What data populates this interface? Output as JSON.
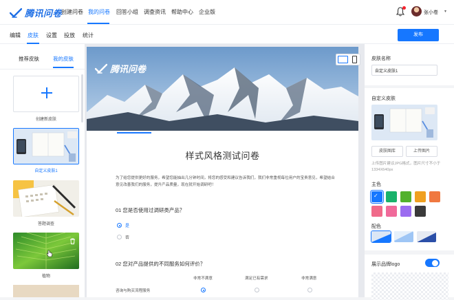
{
  "brand": {
    "name": "腾讯问卷"
  },
  "topnav": {
    "items": [
      {
        "label": "创建问卷"
      },
      {
        "label": "我的问卷"
      },
      {
        "label": "回答小组"
      },
      {
        "label": "调查资讯"
      },
      {
        "label": "帮助中心"
      },
      {
        "label": "企业版"
      }
    ],
    "active_index": 1,
    "user": {
      "name": "张小卷"
    }
  },
  "subnav": {
    "items": [
      {
        "label": "编辑"
      },
      {
        "label": "皮肤"
      },
      {
        "label": "设置"
      },
      {
        "label": "投放"
      },
      {
        "label": "统计"
      }
    ],
    "active_index": 1,
    "publish_label": "发布"
  },
  "left_panel": {
    "tabs": [
      {
        "label": "推荐皮肤"
      },
      {
        "label": "我的皮肤"
      }
    ],
    "active_tab": 1,
    "create_label": "创建新皮肤",
    "skins": [
      {
        "label": "自定义皮肤1",
        "selected": true
      },
      {
        "label": "答题调查",
        "selected": false
      },
      {
        "label": "植物",
        "selected": false
      }
    ]
  },
  "survey": {
    "title": "样式风格测试问卷",
    "intro": "为了给您提供更好的服务，希望您能抽出几分钟时间，将您的感受和建议告诉我们，我们非常重视每位用户的宝贵意见，希望结合意见改善我们的服务，提升产品质量，现在就开始调研吧！",
    "q1": {
      "title": "01 您是否使用过调研类产品？",
      "options": [
        {
          "label": "是",
          "selected": true
        },
        {
          "label": "否",
          "selected": false
        }
      ]
    },
    "q2": {
      "title": "02 您对产品提供的不同服务如何评价？",
      "columns": [
        "非常不满意",
        "满足已有需求",
        "非常满意"
      ],
      "row_label": "咨询与购买流程服务",
      "selected_column": 0
    }
  },
  "right_panel": {
    "skin_name_label": "皮肤名称",
    "skin_name_value": "自定义皮肤1",
    "custom_skin_label": "自定义皮肤",
    "btn_gallery": "皮肤图库",
    "btn_upload": "上传图片",
    "upload_hint": "上传图片建议JPG格式，图片尺寸不小于1334X640px",
    "theme_color_label": "主色",
    "theme_colors": [
      "#1677ff",
      "#1ab26b",
      "#52b12c",
      "#f0a020",
      "#f07840",
      "#f06a8a",
      "#f06a9a",
      "#9b6cf0",
      "#3a3a3a"
    ],
    "selected_color_index": 0,
    "scheme_label": "配色",
    "logo_label": "展示品牌logo",
    "logo_enabled": true
  }
}
